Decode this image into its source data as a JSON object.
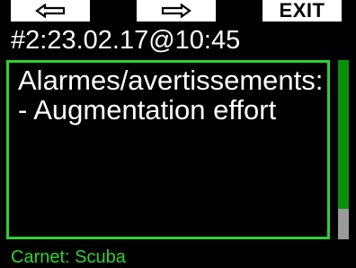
{
  "softkeys": {
    "left_icon": "left-arrow-outline-icon",
    "mid_icon": "right-arrow-outline-icon",
    "right_label": "EXIT"
  },
  "header": {
    "title": "#2:23.02.17@10:45"
  },
  "message": {
    "line1": "Alarmes/avertissements:",
    "line2": "- Augmentation effort"
  },
  "scrollbar": {
    "position_fraction": 1.0
  },
  "footer": {
    "text": "Carnet: Scuba"
  },
  "colors": {
    "accent_green": "#2fd12f",
    "background": "#000000",
    "scroll_track": "#0a8f0a"
  }
}
